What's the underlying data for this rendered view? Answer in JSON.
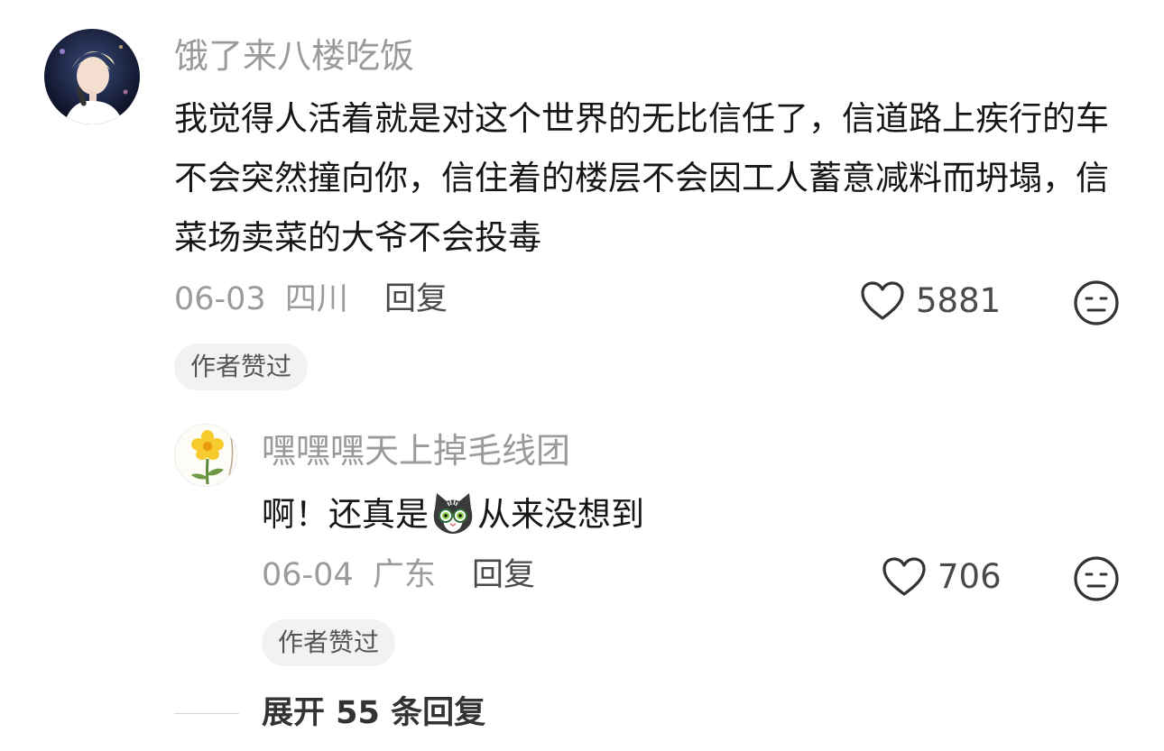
{
  "comments": [
    {
      "username": "饿了来八楼吃饭",
      "text": "我觉得人活着就是对这个世界的无比信任了，信道路上疾行的车不会突然撞向你，信住着的楼层不会因工人蓄意减料而坍塌，信菜场卖菜的大爷不会投毒",
      "date": "06-03",
      "location": "四川",
      "reply_label": "回复",
      "likes": "5881",
      "badge": "作者赞过"
    },
    {
      "username": "嘿嘿嘿天上掉毛线团",
      "text_before": "啊！还真是",
      "text_after": "从来没想到",
      "date": "06-04",
      "location": "广东",
      "reply_label": "回复",
      "likes": "706",
      "badge": "作者赞过"
    }
  ],
  "expand": {
    "label": "展开 55 条回复"
  },
  "icons": {
    "like": "heart-icon",
    "dislike": "meh-face-icon",
    "inline_emoji": "cat-emoji-icon"
  }
}
